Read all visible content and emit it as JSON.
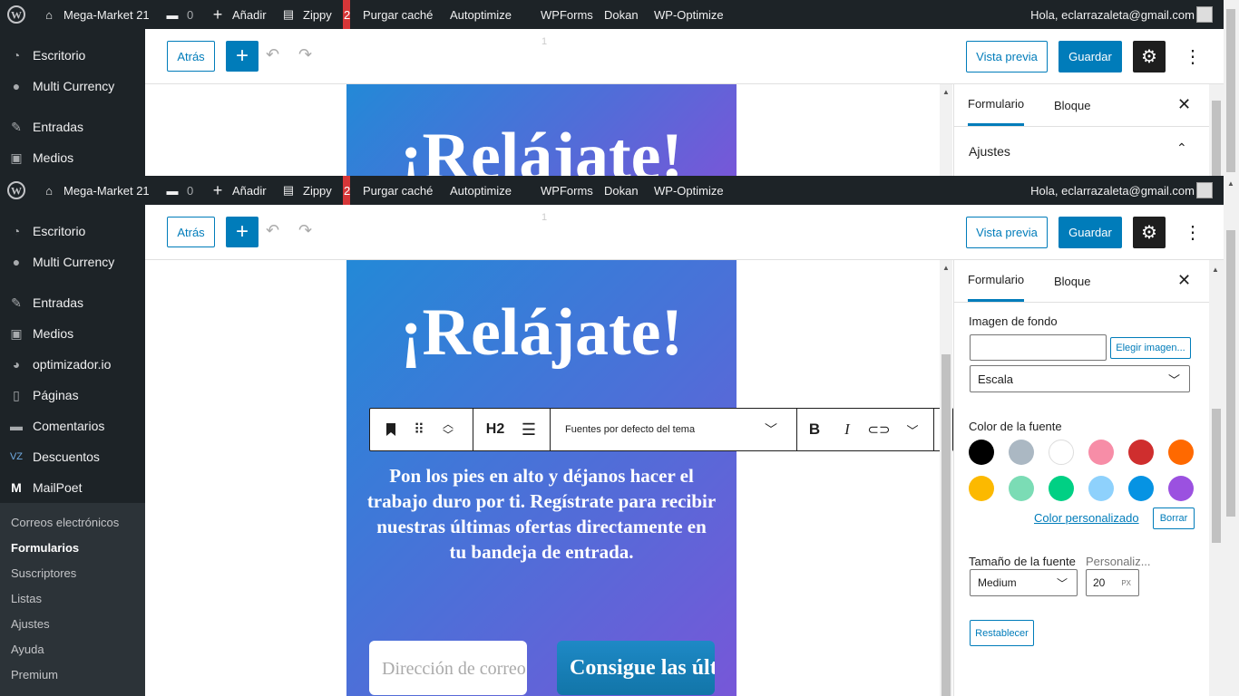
{
  "adminbar": {
    "site_name": "Mega-Market 21",
    "comments_count": "0",
    "new_label": "Añadir",
    "zippy_label": "Zippy",
    "zippy_badge": "2",
    "purge_label": "Purgar caché",
    "autoptimize_label": "Autoptimize",
    "wpforms_label": "WPForms",
    "dokan_label": "Dokan",
    "wpoptimize_label": "WP-Optimize",
    "greeting": "Hola, eclarrazaleta@gmail.com"
  },
  "sidebar": {
    "items": [
      {
        "label": "Escritorio",
        "icon": "dashboard-icon"
      },
      {
        "label": "Multi Currency",
        "icon": "currency-icon"
      },
      {
        "label": "Entradas",
        "icon": "pin-icon"
      },
      {
        "label": "Medios",
        "icon": "media-icon"
      },
      {
        "label": "optimizador.io",
        "icon": "gauge-icon"
      },
      {
        "label": "Páginas",
        "icon": "pages-icon"
      },
      {
        "label": "Comentarios",
        "icon": "comments-icon"
      },
      {
        "label": "Descuentos",
        "icon": "discount-icon"
      },
      {
        "label": "MailPoet",
        "icon": "mailpoet-icon"
      }
    ],
    "submenu": [
      {
        "label": "Correos electrónicos"
      },
      {
        "label": "Formularios"
      },
      {
        "label": "Suscriptores"
      },
      {
        "label": "Listas"
      },
      {
        "label": "Ajustes"
      },
      {
        "label": "Ayuda"
      },
      {
        "label": "Premium"
      }
    ]
  },
  "toolbar": {
    "back_label": "Atrás",
    "add_label": "+",
    "preview_label": "Vista previa",
    "save_label": "Guardar"
  },
  "form": {
    "heading": "¡Relájate!",
    "paragraph": "Pon los pies en alto y déjanos hacer el trabajo duro por ti. Regístrate para recibir nuestras últimas ofertas directamente en tu bandeja de entrada.",
    "email_placeholder": "Dirección de correo electrónico",
    "submit_label": "Consigue las últimas ofertas"
  },
  "block_toolbar": {
    "heading_level": "H2",
    "font_select": "Fuentes por defecto del tema"
  },
  "panel": {
    "tab_form": "Formulario",
    "tab_block": "Bloque",
    "settings_label": "Ajustes",
    "bg_image_label": "Imagen de fondo",
    "choose_image_label": "Elegir imagen...",
    "scale_value": "Escala",
    "font_color_label": "Color de la fuente",
    "custom_color_label": "Color personalizado",
    "clear_label": "Borrar",
    "font_size_label": "Tamaño de la fuente",
    "custom_size_label": "Personaliz...",
    "size_select": "Medium",
    "size_value": "20",
    "size_unit": "PX",
    "reset_label": "Restablecer",
    "colors": [
      "#000000",
      "#abb8c3",
      "#ffffff",
      "#f78da7",
      "#cf2e2e",
      "#ff6900",
      "#fcb900",
      "#7bdcb5",
      "#00d084",
      "#8ed1fc",
      "#0693e3",
      "#9b51e0"
    ]
  },
  "ruler_mark": "1"
}
